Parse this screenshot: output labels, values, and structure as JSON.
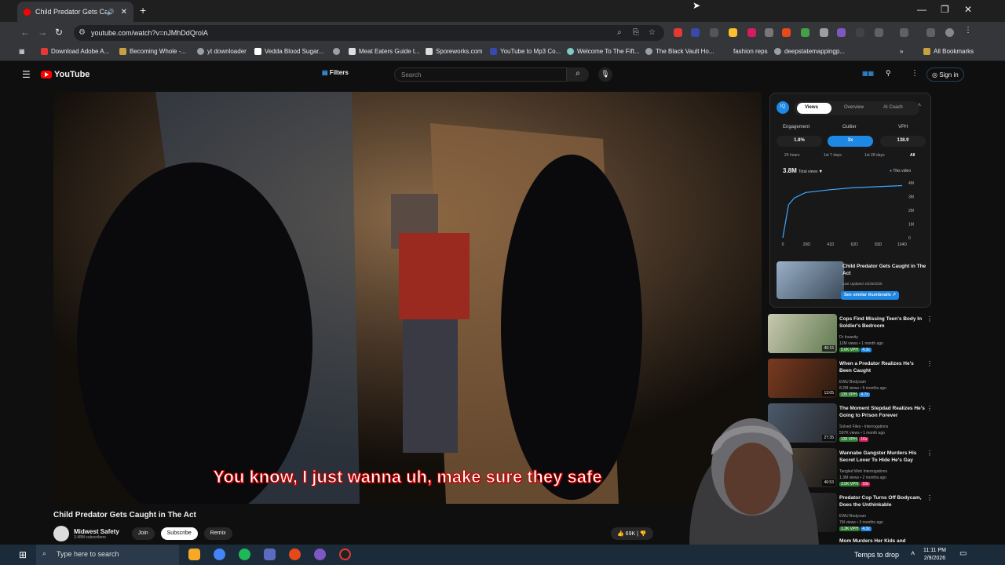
{
  "browser": {
    "tab_title": "Child Predator Gets Caught",
    "url": "youtube.com/watch?v=nJMhDdQrolA",
    "bookmarks": [
      "Download Adobe A...",
      "Becoming Whole -...",
      "yt downloader",
      "Vedda Blood Sugar...",
      "Meat Eaters Guide t...",
      "Sporeworks.com",
      "YouTube to Mp3 Co...",
      "Welcome To The Fift...",
      "The Black Vault Ho...",
      "fashion reps",
      "deepstatemappingp..."
    ],
    "all_bookmarks": "All Bookmarks"
  },
  "youtube": {
    "logo": "YouTube",
    "filters": "Filters",
    "search_placeholder": "Search",
    "sign_in": "Sign in"
  },
  "video": {
    "caption": "You know, I just wanna uh, make sure they safe",
    "title": "Child Predator Gets Caught in The Act",
    "channel": "Midwest Safety",
    "subscribers": "3.48M subscribers",
    "join": "Join",
    "subscribe": "Subscribe",
    "remix": "Remix",
    "likes": "69K"
  },
  "panel": {
    "badge": "IQ",
    "tabs": [
      "Views",
      "Overview",
      "AI Coach"
    ],
    "stat_labels": [
      "Engagement",
      "Outlier",
      "VPH"
    ],
    "stat_values": [
      "1.8%",
      "3x",
      "138.9"
    ],
    "ranges": [
      "24 hours",
      "1st 7 days",
      "1st 28 days",
      "All"
    ],
    "total_views": "3.8M",
    "total_label": "Total views",
    "legend": "This video",
    "y_ticks": [
      "4M",
      "3M",
      "2M",
      "1M",
      "0"
    ],
    "x_ticks": [
      "0",
      "20D",
      "41D",
      "62D",
      "83D",
      "104D"
    ],
    "thumb_title": "Child Predator Gets Caught in The Act",
    "last_updated": "Last Updated 10/26/2025",
    "similar_btn": "See similar thumbnails"
  },
  "chart_data": {
    "type": "line",
    "x": [
      0,
      5,
      10,
      20,
      41,
      62,
      83,
      104
    ],
    "series": [
      {
        "values": [
          0,
          2.4,
          2.9,
          3.3,
          3.5,
          3.65,
          3.72,
          3.8
        ]
      }
    ],
    "ylim": [
      0,
      4
    ]
  },
  "recommendations": [
    {
      "title": "Cops Find Missing Teen's Body In Soldier's Bedroom",
      "channel": "Dr Insanity",
      "meta": "12M views • 1 month ago",
      "vph": "5.6K VPH",
      "mult": "4.3x",
      "duration": "49:15"
    },
    {
      "title": "When a Predator Realizes He's Been Caught",
      "channel": "EWU Bodycam",
      "meta": "8.2M views • 9 months ago",
      "vph": "135 VPH",
      "mult": "4.7x",
      "duration": "13:05"
    },
    {
      "title": "The Moment Stepdad Realizes He's Going to Prison Forever",
      "channel": "Solved Files - Interrogations",
      "meta": "597K views • 1 month ago",
      "vph": "130 VPH",
      "mult": "16x",
      "duration": "27:35"
    },
    {
      "title": "Wannabe Gangster Murders His Secret Lover To Hide He's Gay",
      "channel": "Tangled Web Interrogations",
      "meta": "1.3M views • 2 months ago",
      "vph": "3.5K VPH",
      "mult": "18x",
      "duration": "46:53"
    },
    {
      "title": "Predator Cop Turns Off Bodycam, Does the Unthinkable",
      "channel": "EWU Bodycam",
      "meta": "7M views • 3 months ago",
      "vph": "1.3K VPH",
      "mult": "4.3x",
      "duration": ""
    },
    {
      "title": "Mom Murders Her Kids and",
      "channel": "",
      "meta": "",
      "vph": "",
      "mult": "",
      "duration": ""
    }
  ],
  "taskbar": {
    "search": "Type here to search",
    "weather": "Temps to drop",
    "time": "11:11 PM",
    "date": "2/9/2026"
  }
}
